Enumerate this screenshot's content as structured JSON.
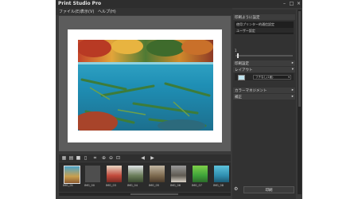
{
  "app": {
    "title": "Print Studio Pro"
  },
  "menu": [
    "ファイル(E)",
    "表示(V)",
    "ヘルプ(H)"
  ],
  "panel": {
    "printer_section": "印刷ように設定",
    "printer_items": [
      "使用プリンター的通信設定",
      "ユーザー設定"
    ],
    "slider_value": "1",
    "print_settings": "印刷設定",
    "layout": "レイアウト",
    "layout_option": "フチなし(1面)",
    "color_adjust": "カラーマネジメント",
    "correction": "補正",
    "print_button": "印刷"
  },
  "thumbnails": [
    {
      "caption": "IMG_01"
    },
    {
      "caption": "IMG_00"
    },
    {
      "caption": "IMG_03"
    },
    {
      "caption": "IMG_04"
    },
    {
      "caption": "IMG_05"
    },
    {
      "caption": "IMG_06"
    },
    {
      "caption": "IMG_07"
    },
    {
      "caption": "IMG_08"
    }
  ],
  "colors": {
    "window_bg": "#3a3a3a",
    "canvas_bg": "#5c5c5c",
    "panel_bg": "#323232"
  }
}
